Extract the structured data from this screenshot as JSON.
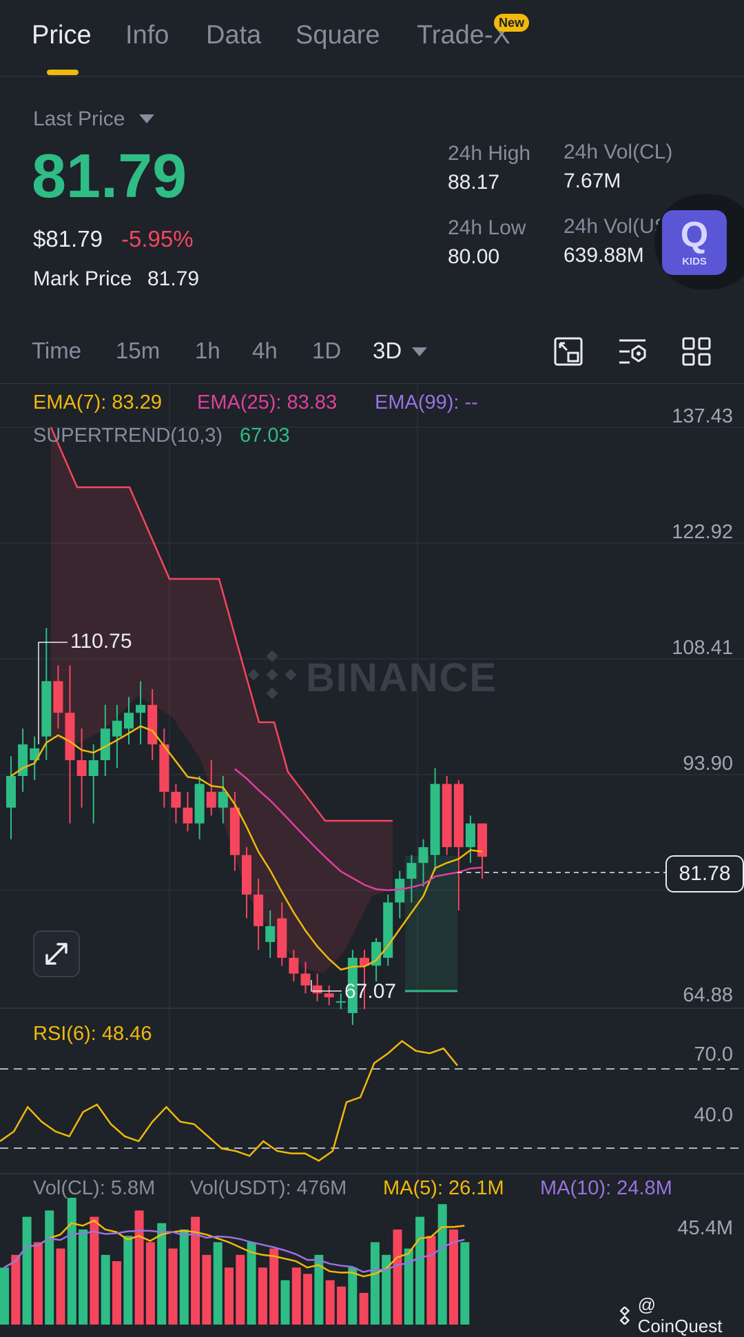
{
  "tabs": [
    {
      "label": "Price",
      "active": true
    },
    {
      "label": "Info",
      "active": false
    },
    {
      "label": "Data",
      "active": false
    },
    {
      "label": "Square",
      "active": false
    },
    {
      "label": "Trade-X",
      "active": false,
      "badge": "New"
    }
  ],
  "price": {
    "label": "Last Price",
    "value": "81.79",
    "usd": "$81.79",
    "change": "-5.95%",
    "mark_label": "Mark Price",
    "mark_value": "81.79"
  },
  "stats": {
    "high_label": "24h High",
    "high": "88.17",
    "low_label": "24h Low",
    "low": "80.00",
    "vol_cl_label": "24h Vol(CL)",
    "vol_cl": "7.67M",
    "vol_usdt_label": "24h Vol(USDT)",
    "vol_usdt": "639.88M"
  },
  "kids": {
    "glyph": "Q",
    "label": "KIDS"
  },
  "intervals": {
    "items": [
      "Time",
      "15m",
      "1h",
      "4h",
      "1D",
      "3D"
    ],
    "selected": "3D"
  },
  "toolbar_icons": [
    "layout-icon",
    "indicator-settings-icon",
    "grid-icon"
  ],
  "legend": {
    "ema7": "EMA(7): 83.29",
    "ema25": "EMA(25): 83.83",
    "ema99": "EMA(99): --",
    "supertrend_label": "SUPERTREND(10,3)",
    "supertrend_value": "67.03"
  },
  "price_axis": [
    "137.43",
    "122.92",
    "108.41",
    "93.90",
    "64.88"
  ],
  "watermark": "BINANCE",
  "current_price_tag": "81.78",
  "hi_marker": "110.75",
  "lo_marker": "67.07",
  "rsi": {
    "label": "RSI(6): 48.46",
    "upper": "70.0",
    "lower": "40.0"
  },
  "volume": {
    "vol_cl": "Vol(CL): 5.8M",
    "vol_usdt": "Vol(USDT): 476M",
    "ma5": "MA(5): 26.1M",
    "ma10": "MA(10): 24.8M",
    "axis_top": "45.4M"
  },
  "footer_credit": "@ CoinQuest",
  "colors": {
    "up": "#2ebd85",
    "down": "#f6465d",
    "ema7": "#f0b90b",
    "ema25": "#e040a0",
    "ema99": "#9a72e0",
    "accent": "#f0b90b"
  },
  "chart_data": {
    "type": "candlestick",
    "interval": "3D",
    "candles": [
      {
        "o": 88.0,
        "h": 94.5,
        "l": 84.0,
        "c": 92.0
      },
      {
        "o": 92.0,
        "h": 98.0,
        "l": 90.0,
        "c": 96.0
      },
      {
        "o": 94.0,
        "h": 97.0,
        "l": 91.5,
        "c": 95.5
      },
      {
        "o": 97.0,
        "h": 110.75,
        "l": 94.0,
        "c": 104.0
      },
      {
        "o": 104.0,
        "h": 106.0,
        "l": 98.0,
        "c": 100.0
      },
      {
        "o": 100.0,
        "h": 106.0,
        "l": 86.0,
        "c": 94.0
      },
      {
        "o": 94.0,
        "h": 98.0,
        "l": 88.0,
        "c": 92.0
      },
      {
        "o": 92.0,
        "h": 96.0,
        "l": 86.0,
        "c": 94.0
      },
      {
        "o": 94.0,
        "h": 101.0,
        "l": 92.0,
        "c": 98.0
      },
      {
        "o": 97.0,
        "h": 101.0,
        "l": 93.0,
        "c": 99.0
      },
      {
        "o": 98.0,
        "h": 102.0,
        "l": 96.0,
        "c": 100.0
      },
      {
        "o": 100.0,
        "h": 104.0,
        "l": 96.0,
        "c": 101.0
      },
      {
        "o": 101.0,
        "h": 103.0,
        "l": 94.0,
        "c": 96.0
      },
      {
        "o": 96.0,
        "h": 98.0,
        "l": 88.0,
        "c": 90.0
      },
      {
        "o": 90.0,
        "h": 91.0,
        "l": 86.0,
        "c": 88.0
      },
      {
        "o": 88.0,
        "h": 90.0,
        "l": 85.0,
        "c": 86.0
      },
      {
        "o": 86.0,
        "h": 92.0,
        "l": 84.0,
        "c": 91.0
      },
      {
        "o": 90.0,
        "h": 94.0,
        "l": 87.0,
        "c": 88.0
      },
      {
        "o": 88.0,
        "h": 92.0,
        "l": 86.0,
        "c": 90.0
      },
      {
        "o": 88.0,
        "h": 90.0,
        "l": 80.0,
        "c": 82.0
      },
      {
        "o": 82.0,
        "h": 83.0,
        "l": 74.0,
        "c": 77.0
      },
      {
        "o": 77.0,
        "h": 79.0,
        "l": 70.0,
        "c": 73.0
      },
      {
        "o": 71.0,
        "h": 75.0,
        "l": 69.0,
        "c": 73.0
      },
      {
        "o": 74.0,
        "h": 76.0,
        "l": 68.0,
        "c": 69.0
      },
      {
        "o": 69.0,
        "h": 70.0,
        "l": 66.0,
        "c": 67.0
      },
      {
        "o": 67.0,
        "h": 68.5,
        "l": 64.5,
        "c": 65.5
      },
      {
        "o": 65.5,
        "h": 67.0,
        "l": 63.5,
        "c": 64.5
      },
      {
        "o": 64.5,
        "h": 65.5,
        "l": 63.0,
        "c": 64.0
      },
      {
        "o": 63.5,
        "h": 64.5,
        "l": 62.5,
        "c": 63.5
      },
      {
        "o": 62.0,
        "h": 70.0,
        "l": 60.5,
        "c": 69.0
      },
      {
        "o": 69.0,
        "h": 70.0,
        "l": 62.5,
        "c": 68.0
      },
      {
        "o": 68.0,
        "h": 71.5,
        "l": 66.0,
        "c": 71.0
      },
      {
        "o": 69.0,
        "h": 77.0,
        "l": 68.0,
        "c": 76.0
      },
      {
        "o": 76.0,
        "h": 80.0,
        "l": 74.0,
        "c": 79.0
      },
      {
        "o": 79.0,
        "h": 82.0,
        "l": 76.0,
        "c": 81.0
      },
      {
        "o": 81.0,
        "h": 84.0,
        "l": 78.0,
        "c": 83.0
      },
      {
        "o": 82.0,
        "h": 93.0,
        "l": 80.0,
        "c": 91.0
      },
      {
        "o": 91.0,
        "h": 92.0,
        "l": 82.0,
        "c": 83.0
      },
      {
        "o": 91.0,
        "h": 91.5,
        "l": 75.0,
        "c": 83.0
      },
      {
        "o": 83.0,
        "h": 87.0,
        "l": 81.0,
        "c": 86.0
      },
      {
        "o": 86.0,
        "h": 86.0,
        "l": 79.0,
        "c": 81.78
      }
    ],
    "y_ticks": [
      137.43,
      122.92,
      108.41,
      93.9,
      79.39,
      64.88
    ],
    "rsi_values": [
      38,
      42,
      52,
      46,
      42,
      40,
      50,
      53,
      45,
      40,
      38,
      46,
      52,
      46,
      45,
      40,
      35,
      34,
      32,
      38,
      34,
      33,
      33,
      30,
      34,
      54,
      56,
      70,
      74,
      79,
      75,
      74,
      76,
      69
    ],
    "volume_values": [
      18,
      22,
      34,
      26,
      36,
      24,
      40,
      30,
      34,
      22,
      20,
      28,
      36,
      26,
      32,
      24,
      30,
      34,
      22,
      26,
      18,
      22,
      26,
      18,
      24,
      14,
      18,
      16,
      22,
      14,
      12,
      18,
      10,
      26,
      22,
      30,
      24,
      34,
      28,
      38,
      30,
      26
    ],
    "volume_up": [
      true,
      false,
      true,
      false,
      true,
      false,
      true,
      true,
      false,
      true,
      false,
      true,
      false,
      false,
      true,
      false,
      true,
      false,
      false,
      true,
      false,
      false,
      true,
      false,
      false,
      true,
      false,
      false,
      true,
      false,
      false,
      true,
      false,
      true,
      true,
      false,
      true,
      true,
      false,
      true,
      false,
      true
    ]
  }
}
